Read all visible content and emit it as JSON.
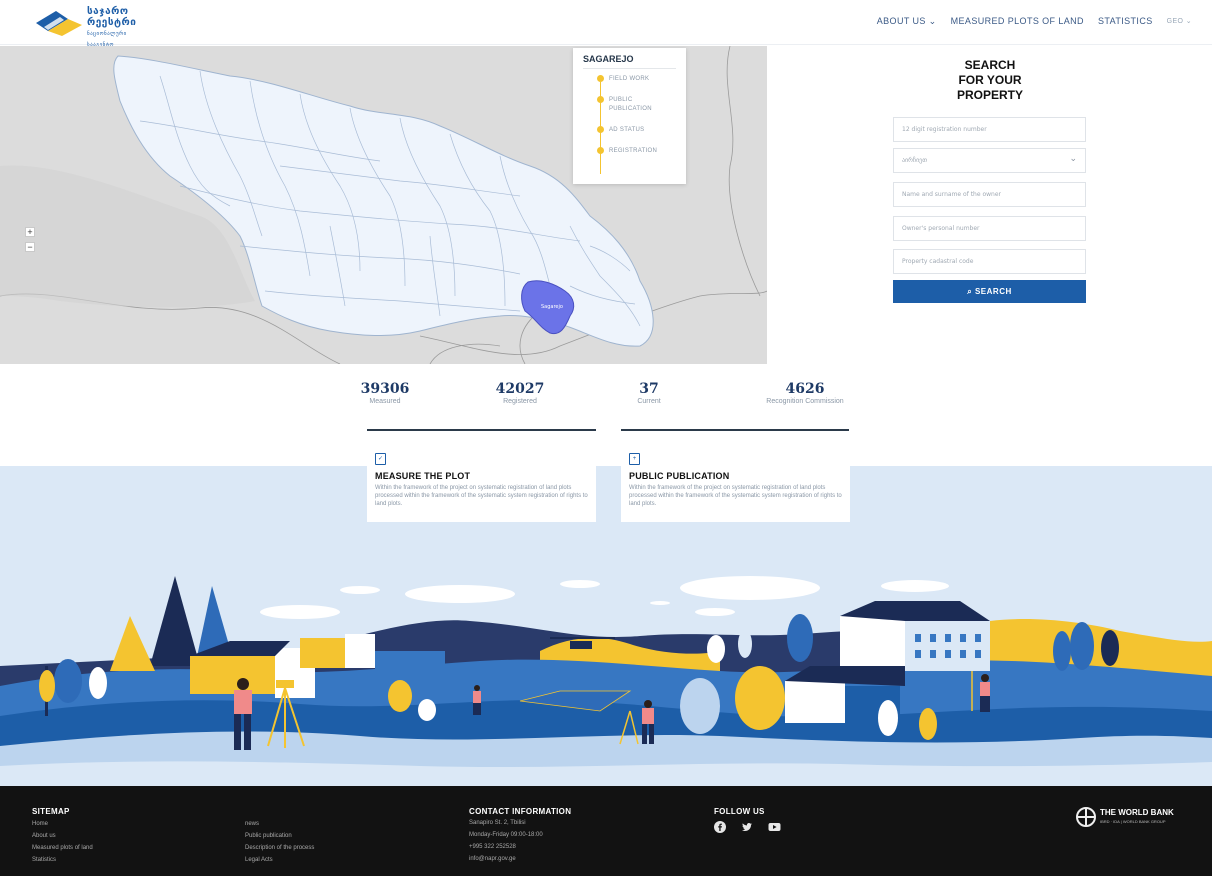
{
  "header": {
    "logo_text_line1": "საჯარო",
    "logo_text_line2": "რეესტრი",
    "logo_small": "ნაციონალური სააგენტო",
    "nav": [
      {
        "label": "ABOUT US ⌄"
      },
      {
        "label": "MEASURED PLOTS OF LAND"
      },
      {
        "label": "STATISTICS"
      },
      {
        "label": "GEO ⌄"
      }
    ]
  },
  "map": {
    "region_label": "Sagarejo",
    "zoom_in": "+",
    "zoom_out": "−",
    "legend": {
      "title": "SAGAREJO",
      "items": [
        "FIELD WORK",
        "PUBLIC PUBLICATION",
        "AD STATUS",
        "REGISTRATION"
      ]
    }
  },
  "search": {
    "title_line1": "SEARCH",
    "title_line2": "FOR YOUR",
    "title_line3": "PROPERTY",
    "fields": {
      "registration_number": "12 digit registration number",
      "municipality": "აირჩიეთ",
      "owner_name": "Name and surname of the owner",
      "personal_number": "Owner's personal number",
      "cadastral_code": "Property cadastral code"
    },
    "button_label": "SEARCH",
    "search_icon": "search-icon"
  },
  "stats": [
    {
      "value": "39306",
      "label": "Measured"
    },
    {
      "value": "42027",
      "label": "Registered"
    },
    {
      "value": "37",
      "label": "Current"
    },
    {
      "value": "4626",
      "label": "Recognition Commission"
    }
  ],
  "cards": [
    {
      "icon": "checklist-icon",
      "title": "MEASURE THE PLOT",
      "text": "Within the framework of the project on systematic registration of land plots processed within the framework of the systematic system registration of rights to land plots."
    },
    {
      "icon": "document-icon",
      "title": "PUBLIC PUBLICATION",
      "text": "Within the framework of the project on systematic registration of land plots processed within the framework of the systematic system registration of rights to land plots."
    }
  ],
  "footer": {
    "sitemap_title": "SITEMAP",
    "sitemap_col1": [
      "Home",
      "About us",
      "Measured plots of land",
      "Statistics"
    ],
    "sitemap_col2": [
      "news",
      "Public publication",
      "Description of the process",
      "Legal Acts"
    ],
    "contact_title": "CONTACT INFORMATION",
    "contact": [
      "Sanapiro St. 2, Tbilisi",
      "Monday-Friday 09:00-18:00",
      "+995 322 252528",
      "info@napr.gov.ge"
    ],
    "follow_title": "FOLLOW US",
    "social_icons": [
      "facebook-icon",
      "twitter-icon",
      "youtube-icon"
    ],
    "worldbank_name": "THE WORLD BANK",
    "worldbank_sub": "IBRD · IDA | WORLD BANK GROUP"
  },
  "colors": {
    "brand_blue": "#1d5ea8",
    "accent_yellow": "#f4c430",
    "highlight_region": "#6b73e8",
    "map_land": "#eef4fc",
    "footer_bg": "#121212"
  }
}
